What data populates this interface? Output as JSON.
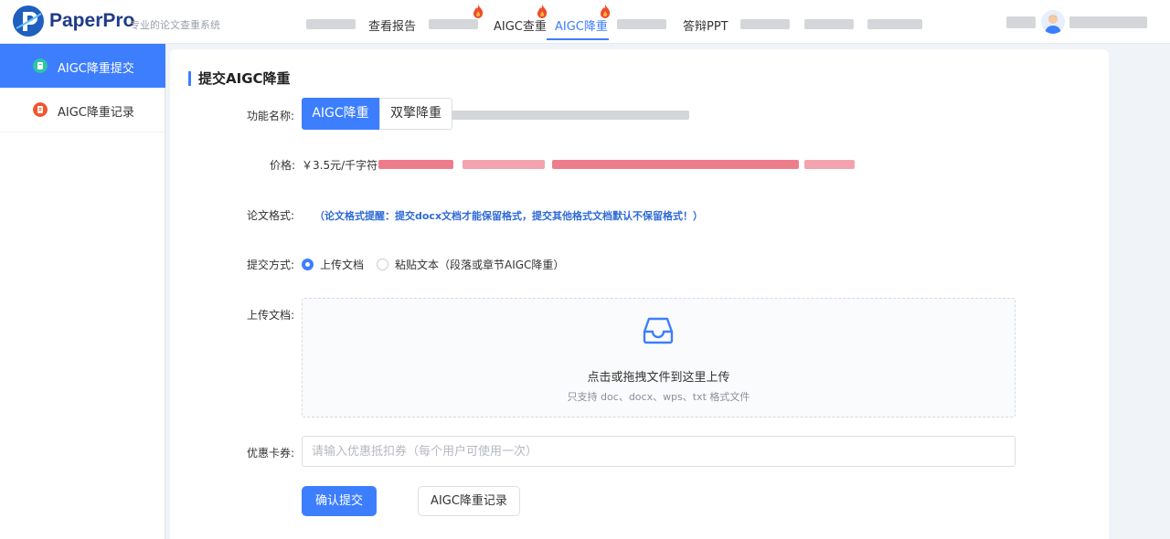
{
  "header": {
    "brand": "PaperPro",
    "slogan": "专业的论文查重系统",
    "nav": [
      {
        "label": "查看报告"
      },
      {
        "label": "AIGC查重"
      },
      {
        "label": "AIGC降重"
      },
      {
        "label": "答辩PPT"
      }
    ],
    "active_nav": "AIGC降重"
  },
  "sidebar": {
    "items": [
      {
        "label": "AIGC降重提交",
        "active": true
      },
      {
        "label": "AIGC降重记录",
        "active": false
      }
    ]
  },
  "form": {
    "title": "提交AIGC降重",
    "function_label": "功能名称:",
    "function_options": [
      "AIGC降重",
      "双擎降重"
    ],
    "price_label": "价格:",
    "price_value": "￥3.5元/千字符",
    "format_label": "论文格式:",
    "format_tip": "（论文格式提醒：提交docx文档才能保留格式，提交其他格式文档默认不保留格式！）",
    "submit_method_label": "提交方式:",
    "submit_methods": [
      "上传文档",
      "粘贴文本（段落或章节AIGC降重）"
    ],
    "upload_label": "上传文档:",
    "upload_main": "点击或拖拽文件到这里上传",
    "upload_sub": "只支持 doc、docx、wps、txt 格式文件",
    "coupon_label": "优惠卡券:",
    "coupon_placeholder": "请输入优惠抵扣券（每个用户可使用一次）",
    "submit_button": "确认提交",
    "records_button": "AIGC降重记录"
  },
  "colors": {
    "accent": "#3d7eff",
    "tip": "#2f6bd8",
    "brand": "#1f3a8a"
  }
}
